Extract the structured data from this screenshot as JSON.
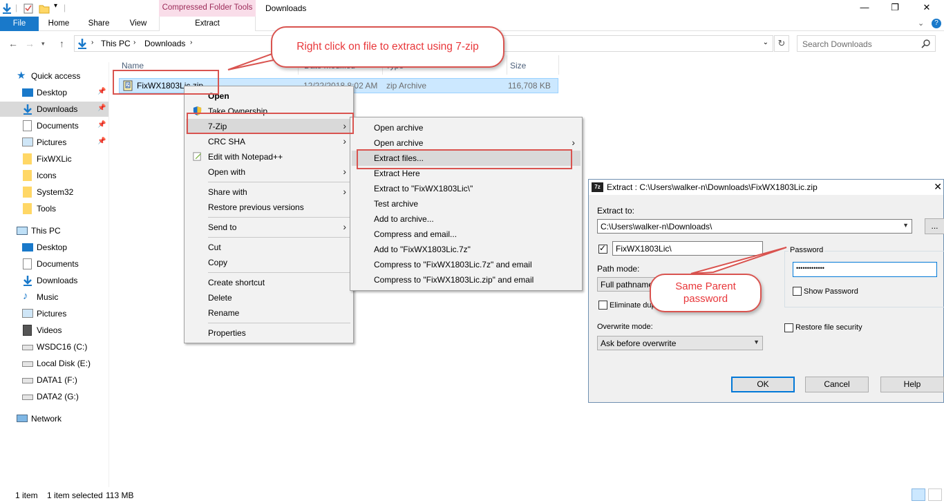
{
  "titlebar": {
    "context_tab_header": "Compressed Folder Tools",
    "window_title": "Downloads",
    "minimize": "—",
    "maximize": "❐",
    "close": "✕"
  },
  "ribbon": {
    "file": "File",
    "home": "Home",
    "share": "Share",
    "view": "View",
    "extract": "Extract"
  },
  "address": {
    "crumbs": [
      "This PC",
      "Downloads"
    ],
    "search_placeholder": "Search Downloads"
  },
  "nav": {
    "quick_access": "Quick access",
    "quick_items": [
      "Desktop",
      "Downloads",
      "Documents",
      "Pictures",
      "FixWXLic",
      "Icons",
      "System32",
      "Tools"
    ],
    "this_pc": "This PC",
    "pc_items": [
      "Desktop",
      "Documents",
      "Downloads",
      "Music",
      "Pictures",
      "Videos",
      "WSDC16 (C:)",
      "Local Disk (E:)",
      "DATA1 (F:)",
      "DATA2 (G:)"
    ],
    "network": "Network"
  },
  "filelist": {
    "columns": {
      "name": "Name",
      "date": "Date modified",
      "type": "Type",
      "size": "Size"
    },
    "file": {
      "name": "FixWX1803Lic.zip",
      "date": "12/22/2018 8:02 AM",
      "type": "zip Archive",
      "size": "116,708 KB"
    }
  },
  "callouts": {
    "top": "Right click on file to extract using 7-zip",
    "password": "Same Parent password"
  },
  "context_menu": {
    "items": [
      "Open",
      "Take Ownership",
      "7-Zip",
      "CRC SHA",
      "Edit with Notepad++",
      "Open with",
      "Share with",
      "Restore previous versions",
      "Send to",
      "Cut",
      "Copy",
      "Create shortcut",
      "Delete",
      "Rename",
      "Properties"
    ]
  },
  "zip_submenu": {
    "items": [
      "Open archive",
      "Open archive",
      "Extract files...",
      "Extract Here",
      "Extract to \"FixWX1803Lic\\\"",
      "Test archive",
      "Add to archive...",
      "Compress and email...",
      "Add to \"FixWX1803Lic.7z\"",
      "Compress to \"FixWX1803Lic.7z\" and email",
      "Compress to \"FixWX1803Lic.zip\" and email"
    ]
  },
  "dialog": {
    "icon_text": "7z",
    "title": "Extract : C:\\Users\\walker-n\\Downloads\\FixWX1803Lic.zip",
    "extract_to_label": "Extract to:",
    "extract_to_value": "C:\\Users\\walker-n\\Downloads\\",
    "browse_label": "...",
    "subfolder_value": "FixWX1803Lic\\",
    "path_mode_label": "Path mode:",
    "path_mode_value": "Full pathnames",
    "eliminate_label": "Eliminate dup",
    "password_label": "Password",
    "password_value": "•••••••••••••",
    "show_password_label": "Show Password",
    "overwrite_label": "Overwrite mode:",
    "overwrite_value": "Ask before overwrite",
    "restore_security_label": "Restore file security",
    "ok": "OK",
    "cancel": "Cancel",
    "help": "Help"
  },
  "statusbar": {
    "items": "1 item",
    "selected": "1 item selected",
    "size": "113 MB"
  }
}
